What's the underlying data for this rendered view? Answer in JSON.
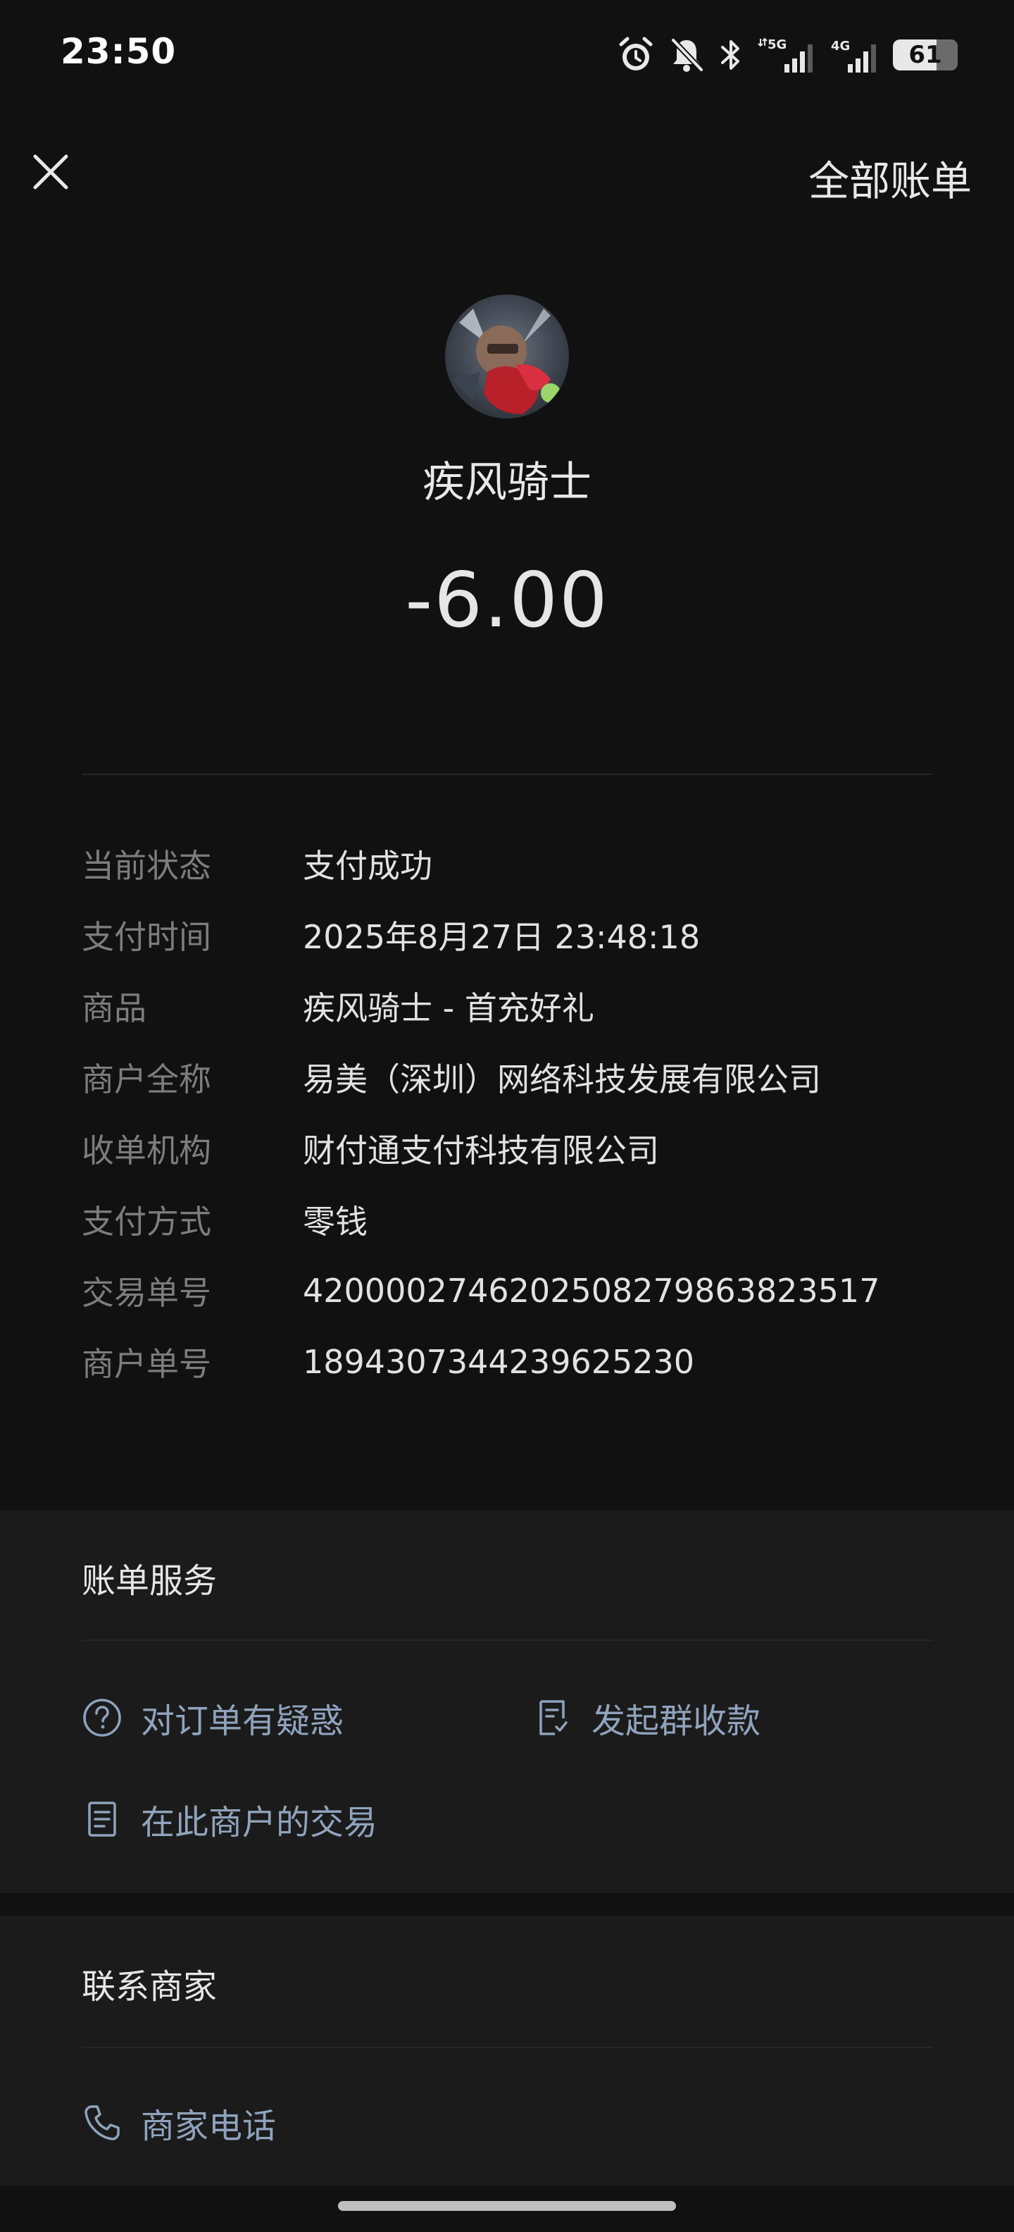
{
  "status_bar": {
    "time": "23:50",
    "network_5g": "5G",
    "network_4g": "4G",
    "battery": "61",
    "icons": [
      "alarm-icon",
      "mute-bell-icon",
      "bluetooth-icon",
      "signal-5g-icon",
      "signal-4g-icon",
      "battery-icon"
    ]
  },
  "nav": {
    "close_icon": "close-icon",
    "all_bills": "全部账单"
  },
  "header": {
    "merchant_name": "疾风骑士",
    "amount": "-6.00"
  },
  "details": [
    {
      "label": "当前状态",
      "value": "支付成功"
    },
    {
      "label": "支付时间",
      "value": "2025年8月27日 23:48:18"
    },
    {
      "label": "商品",
      "value": "疾风骑士 - 首充好礼"
    },
    {
      "label": "商户全称",
      "value": "易美（深圳）网络科技发展有限公司"
    },
    {
      "label": "收单机构",
      "value": "财付通支付科技有限公司"
    },
    {
      "label": "支付方式",
      "value": "零钱"
    },
    {
      "label": "交易单号",
      "value": "4200002746202508279863823517"
    },
    {
      "label": "商户单号",
      "value": "1894307344239625230"
    }
  ],
  "bill_services": {
    "title": "账单服务",
    "items": [
      {
        "label": "对订单有疑惑",
        "icon": "question-circle-icon"
      },
      {
        "label": "发起群收款",
        "icon": "receipt-icon"
      },
      {
        "label": "在此商户的交易",
        "icon": "document-icon"
      }
    ]
  },
  "contact": {
    "title": "联系商家",
    "items": [
      {
        "label": "商家电话",
        "icon": "phone-icon"
      }
    ]
  },
  "colors": {
    "background": "#111111",
    "section_background": "#1b1b1b",
    "link": "#8fa3bd",
    "label": "#7d7d7d"
  }
}
